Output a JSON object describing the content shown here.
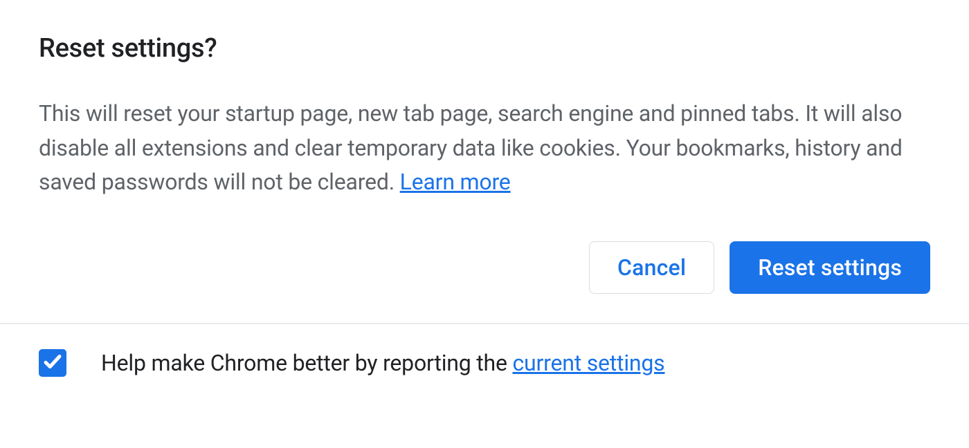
{
  "dialog": {
    "title": "Reset settings?",
    "body_text": "This will reset your startup page, new tab page, search engine and pinned tabs. It will also disable all extensions and clear temporary data like cookies. Your bookmarks, history and saved passwords will not be cleared.  ",
    "learn_more": "Learn more",
    "cancel_label": "Cancel",
    "confirm_label": "Reset settings"
  },
  "footer": {
    "checkbox_checked": true,
    "help_text_prefix": "Help make Chrome better by reporting the ",
    "current_settings_link": "current settings"
  },
  "colors": {
    "primary": "#1a73e8",
    "text_primary": "#202124",
    "text_secondary": "#5f6368",
    "border": "#dadce0"
  }
}
